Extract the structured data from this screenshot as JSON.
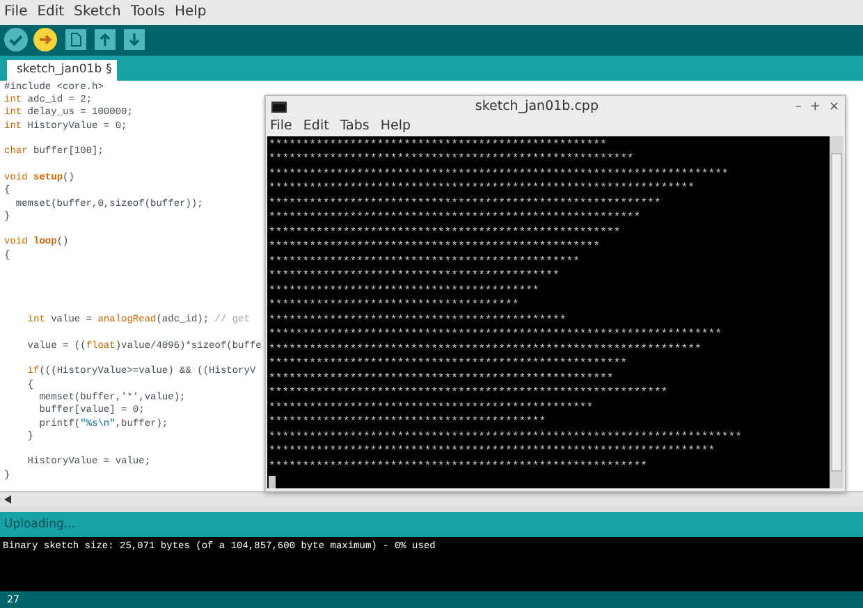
{
  "menu": [
    "File",
    "Edit",
    "Sketch",
    "Tools",
    "Help"
  ],
  "toolbar": [
    {
      "kind": "verify"
    },
    {
      "kind": "upload"
    },
    {
      "kind": "new"
    },
    {
      "kind": "open"
    },
    {
      "kind": "save"
    }
  ],
  "tabs": [
    {
      "label": "sketch_jan01b",
      "menu_mark": "§",
      "selected": true
    }
  ],
  "code": [
    {
      "kind": "code",
      "tokens": [
        {
          "text": "#include <core.h>",
          "kind": "plain"
        }
      ]
    },
    {
      "kind": "code",
      "tokens": [
        {
          "text": "int",
          "kind": "keyword"
        },
        {
          "text": " adc_id = 2;",
          "kind": "plain"
        }
      ]
    },
    {
      "kind": "code",
      "tokens": [
        {
          "text": "int",
          "kind": "keyword"
        },
        {
          "text": " delay_us = 100000;",
          "kind": "plain"
        }
      ]
    },
    {
      "kind": "code",
      "tokens": [
        {
          "text": "int",
          "kind": "keyword"
        },
        {
          "text": " HistoryValue = 0;",
          "kind": "plain"
        }
      ]
    },
    {
      "kind": "blank"
    },
    {
      "kind": "code",
      "tokens": [
        {
          "text": "char",
          "kind": "keyword"
        },
        {
          "text": " buffer[100];",
          "kind": "plain"
        }
      ]
    },
    {
      "kind": "blank"
    },
    {
      "kind": "code",
      "tokens": [
        {
          "text": "void",
          "kind": "keyword"
        },
        {
          "text": " setup",
          "kind": "function"
        },
        {
          "text": "()",
          "kind": "plain"
        }
      ]
    },
    {
      "kind": "code",
      "tokens": [
        {
          "text": "{",
          "kind": "plain"
        }
      ]
    },
    {
      "kind": "code",
      "tokens": [
        {
          "text": "  memset(buffer,0,sizeof(buffer));",
          "kind": "plain"
        }
      ]
    },
    {
      "kind": "code",
      "tokens": [
        {
          "text": "}",
          "kind": "plain"
        }
      ]
    },
    {
      "kind": "blank"
    },
    {
      "kind": "code",
      "tokens": [
        {
          "text": "void",
          "kind": "keyword"
        },
        {
          "text": " loop",
          "kind": "function"
        },
        {
          "text": "()",
          "kind": "plain"
        }
      ]
    },
    {
      "kind": "code",
      "tokens": [
        {
          "text": "{",
          "kind": "plain"
        }
      ]
    },
    {
      "kind": "blank"
    },
    {
      "kind": "blank"
    },
    {
      "kind": "blank"
    },
    {
      "kind": "blank"
    },
    {
      "kind": "code",
      "tokens": [
        {
          "text": "    int",
          "kind": "keyword"
        },
        {
          "text": " value = ",
          "kind": "plain"
        },
        {
          "text": "analogRead",
          "kind": "builtin"
        },
        {
          "text": "(adc_id); ",
          "kind": "plain"
        },
        {
          "text": "// get",
          "kind": "comment"
        }
      ]
    },
    {
      "kind": "blank"
    },
    {
      "kind": "code",
      "tokens": [
        {
          "text": "    value = ((",
          "kind": "plain"
        },
        {
          "text": "float",
          "kind": "keyword"
        },
        {
          "text": ")value/4096)*sizeof(buffe",
          "kind": "plain"
        }
      ]
    },
    {
      "kind": "blank"
    },
    {
      "kind": "code",
      "tokens": [
        {
          "text": "    if",
          "kind": "keyword"
        },
        {
          "text": "(((HistoryValue>=value) && ((HistoryV",
          "kind": "plain"
        }
      ]
    },
    {
      "kind": "code",
      "tokens": [
        {
          "text": "    {",
          "kind": "plain"
        }
      ]
    },
    {
      "kind": "code",
      "tokens": [
        {
          "text": "      memset(buffer,'*',value);",
          "kind": "plain"
        }
      ]
    },
    {
      "kind": "code",
      "tokens": [
        {
          "text": "      buffer[value] = 0;",
          "kind": "plain"
        }
      ]
    },
    {
      "kind": "code",
      "tokens": [
        {
          "text": "      printf(",
          "kind": "plain"
        },
        {
          "text": "\"%s\\n\"",
          "kind": "string"
        },
        {
          "text": ",buffer);",
          "kind": "plain"
        }
      ]
    },
    {
      "kind": "code",
      "tokens": [
        {
          "text": "    }",
          "kind": "plain"
        }
      ]
    },
    {
      "kind": "blank"
    },
    {
      "kind": "code",
      "tokens": [
        {
          "text": "    HistoryValue = value;",
          "kind": "plain"
        }
      ]
    },
    {
      "kind": "code",
      "tokens": [
        {
          "text": "}",
          "kind": "plain"
        }
      ]
    }
  ],
  "terminal": {
    "title": "sketch_jan01b.cpp",
    "controls": [
      "–",
      "+",
      "×"
    ],
    "menu": [
      "File",
      "Edit",
      "Tabs",
      "Help"
    ],
    "output": "**************************************************\n******************************************************\n********************************************************************\n***************************************************************\n**********************************************************\n*******************************************************\n****************************************************\n*************************************************\n**********************************************\n*******************************************\n****************************************\n*************************************\n********************************************\n*******************************************************************\n****************************************************************\n*****************************************************\n***************************************************\n***********************************************************\n************************************************\n*****************************************\n**********************************************************************\n******************************************************************\n********************************************************"
  },
  "status": "Uploading...",
  "console": [
    "Binary sketch size: 25,071 bytes (of a 104,857,600 byte maximum) - 0% used"
  ],
  "footer": "27"
}
